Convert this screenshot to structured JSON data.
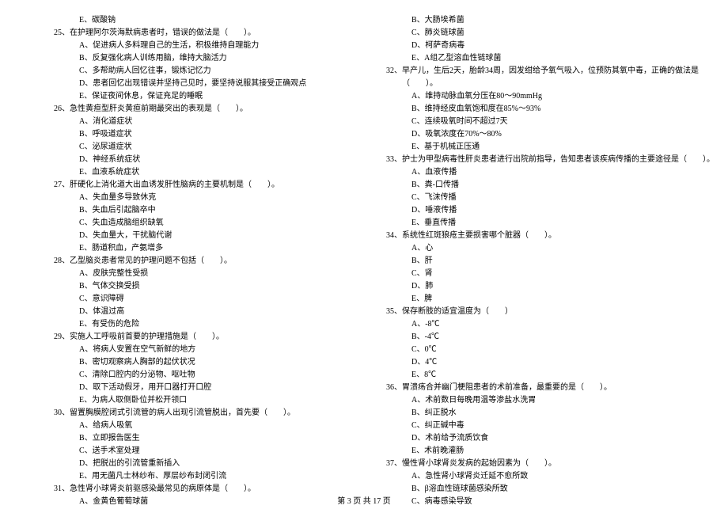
{
  "left_column": {
    "pre_option": "E、碳酸钠",
    "questions": [
      {
        "num": "25",
        "text": "在护理阿尔茨海默病患者时，错误的做法是（　　）。",
        "options": [
          "A、促进病人多料理自己的生活，积极维持自理能力",
          "B、反复强化病人训练用脑，维持大脑活力",
          "C、多帮助病人回忆往事，锻炼记忆力",
          "D、患者回忆出现错误并坚持己见时，要坚持说服其接受正确观点",
          "E、保证夜间休息，保证充足的睡眠"
        ]
      },
      {
        "num": "26",
        "text": "急性黄疸型肝炎黄疸前期最突出的表现是（　　）。",
        "options": [
          "A、消化道症状",
          "B、呼吸道症状",
          "C、泌尿道症状",
          "D、神经系统症状",
          "E、血液系统症状"
        ]
      },
      {
        "num": "27",
        "text": "肝硬化上消化道大出血诱发肝性脑病的主要机制是（　　）。",
        "options": [
          "A、失血量多导致休克",
          "B、失血后引起脑卒中",
          "C、失血造成脑组织缺氧",
          "D、失血量大，干扰脑代谢",
          "E、肠道积血，产氨增多"
        ]
      },
      {
        "num": "28",
        "text": "乙型脑炎患者常见的护理问题不包括（　　）。",
        "options": [
          "A、皮肤完整性受损",
          "B、气体交换受损",
          "C、意识障碍",
          "D、体温过高",
          "E、有受伤的危险"
        ]
      },
      {
        "num": "29",
        "text": "实施人工呼吸前首要的护理措施是（　　）。",
        "options": [
          "A、将病人安置在空气新鲜的地方",
          "B、密切观察病人胸部的起伏状况",
          "C、清除口腔内的分泌物、呕吐物",
          "D、取下活动假牙，用开口器打开口腔",
          "E、为病人取侧卧位并松开领口"
        ]
      },
      {
        "num": "30",
        "text": "留置胸膜腔闭式引流管的病人出现引流管脱出，首先要（　　）。",
        "options": [
          "A、给病人吸氧",
          "B、立即报告医生",
          "C、送手术室处理",
          "D、把脱出的引流管重新插入",
          "E、用无菌凡士林纱布、厚层纱布封闭引流"
        ]
      },
      {
        "num": "31",
        "text": "急性肾小球肾炎前驱感染最常见的病原体是（　　）。",
        "options": [
          "A、金黄色葡萄球菌"
        ]
      }
    ]
  },
  "right_column": {
    "pre_options": [
      "B、大肠埃希菌",
      "C、肺炎链球菌",
      "D、柯萨奇病毒",
      "E、A组乙型溶血性链球菌"
    ],
    "questions": [
      {
        "num": "32",
        "text": "早产儿，生后2天，胎龄34周，因发绀给予氧气吸入，位预防其氧中毒，正确的做法是",
        "tail": "（　　）。",
        "options": [
          "A、维持动脉血氧分压在80～90mmHg",
          "B、维持经皮血氧饱和度在85%～93%",
          "C、连续吸氧时间不超过7天",
          "D、吸氧浓度在70%～80%",
          "E、基于机械正压通"
        ]
      },
      {
        "num": "33",
        "text": "护士为甲型病毒性肝炎患者进行出院前指导，告知患者该疾病传播的主要途径是（　　）。",
        "options": [
          "A、血液传播",
          "B、粪-口传播",
          "C、飞沫传播",
          "D、唾液传播",
          "E、垂直传播"
        ]
      },
      {
        "num": "34",
        "text": "系统性红斑狼疮主要损害哪个脏器（　　）。",
        "options": [
          "A、心",
          "B、肝",
          "C、肾",
          "D、肺",
          "E、脾"
        ]
      },
      {
        "num": "35",
        "text": "保存断肢的适宜温度为（　　）",
        "options": [
          "A、-8℃",
          "B、-4℃",
          "C、0℃",
          "D、4℃",
          "E、8℃"
        ]
      },
      {
        "num": "36",
        "text": "胃溃疡合并幽门梗阻患者的术前准备，最重要的是（　　）。",
        "options": [
          "A、术前数日每晚用温等渗盐水洗胃",
          "B、纠正脱水",
          "C、纠正碱中毒",
          "D、术前给予流质饮食",
          "E、术前晚灌肠"
        ]
      },
      {
        "num": "37",
        "text": "慢性肾小球肾炎发病的起始因素为（　　）。",
        "options": [
          "A、急性肾小球肾炎迁延不愈所致",
          "B、β溶血性链球菌感染所致",
          "C、病毒感染导致"
        ]
      }
    ]
  },
  "footer": "第 3 页 共 17 页"
}
